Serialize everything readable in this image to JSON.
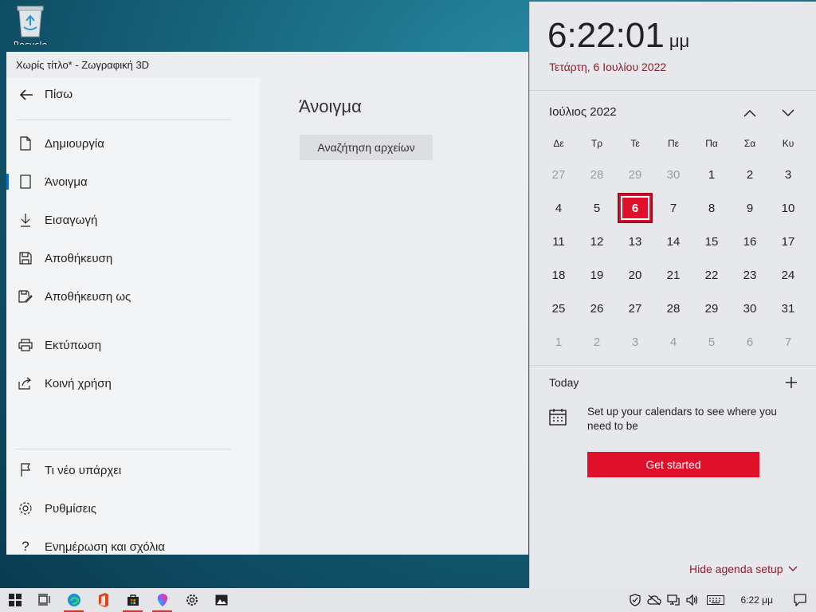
{
  "desktop": {
    "recycle_bin_label": "Recycle Bin"
  },
  "app": {
    "title": "Χωρίς τίτλο* - Ζωγραφική 3D",
    "back_label": "Πίσω",
    "menu": [
      {
        "label": "Δημιουργία"
      },
      {
        "label": "Άνοιγμα"
      },
      {
        "label": "Εισαγωγή"
      },
      {
        "label": "Αποθήκευση"
      },
      {
        "label": "Αποθήκευση ως"
      },
      {
        "label": "Εκτύπωση"
      },
      {
        "label": "Κοινή χρήση"
      },
      {
        "label": "Τι νέο υπάρχει"
      },
      {
        "label": "Ρυθμίσεις"
      },
      {
        "label": "Ενημέρωση και σχόλια"
      }
    ],
    "main": {
      "heading": "Άνοιγμα",
      "browse_button": "Αναζήτηση αρχείων"
    }
  },
  "flyout": {
    "time": "6:22:01",
    "ampm": "μμ",
    "date": "Τετάρτη, 6 Ιουλίου 2022",
    "month_label": "Ιούλιος 2022",
    "weekdays": [
      "Δε",
      "Τρ",
      "Τε",
      "Πε",
      "Πα",
      "Σα",
      "Κυ"
    ],
    "days": [
      [
        "27",
        "28",
        "29",
        "30",
        "1",
        "2",
        "3"
      ],
      [
        "4",
        "5",
        "6",
        "7",
        "8",
        "9",
        "10"
      ],
      [
        "11",
        "12",
        "13",
        "14",
        "15",
        "16",
        "17"
      ],
      [
        "18",
        "19",
        "20",
        "21",
        "22",
        "23",
        "24"
      ],
      [
        "25",
        "26",
        "27",
        "28",
        "29",
        "30",
        "31"
      ],
      [
        "1",
        "2",
        "3",
        "4",
        "5",
        "6",
        "7"
      ]
    ],
    "today_label": "Today",
    "agenda_message": "Set up your calendars to see where you need to be",
    "get_started": "Get started",
    "hide_agenda": "Hide agenda setup"
  },
  "taskbar": {
    "clock": "6:22 μμ"
  },
  "colors": {
    "accent_red": "#e0102a",
    "date_red": "#8a1f2e",
    "active_blue": "#0f6cbd"
  }
}
